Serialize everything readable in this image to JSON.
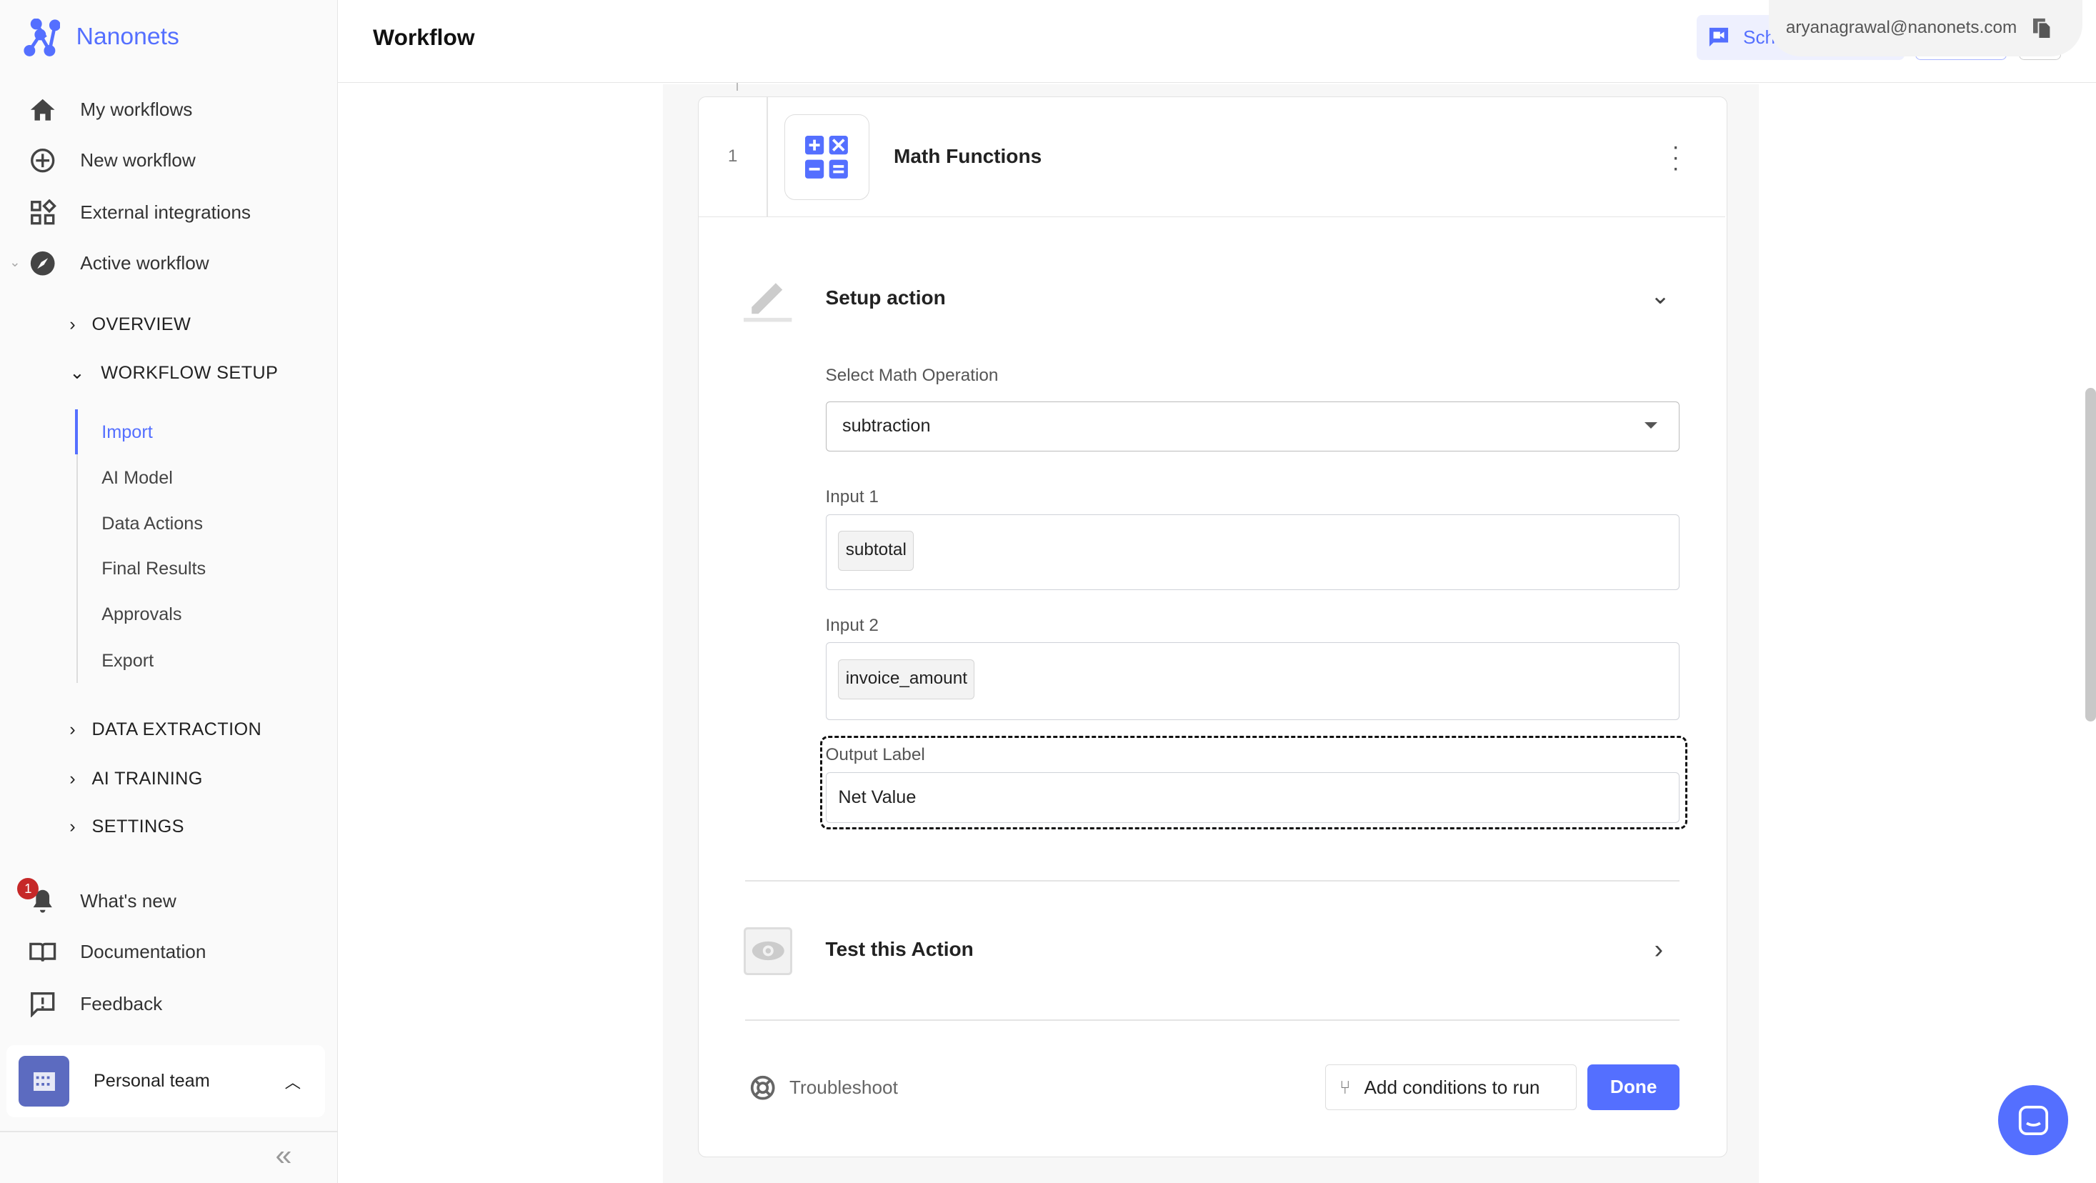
{
  "brand": {
    "name": "Nanonets",
    "color": "#546fff"
  },
  "sidebar": {
    "nav": [
      {
        "label": "My workflows",
        "icon": "home-icon"
      },
      {
        "label": "New workflow",
        "icon": "plus-circle-icon"
      },
      {
        "label": "External integrations",
        "icon": "widgets-icon"
      },
      {
        "label": "Active workflow",
        "icon": "compass-icon"
      }
    ],
    "sections": [
      {
        "label": "OVERVIEW"
      },
      {
        "label": "WORKFLOW SETUP"
      }
    ],
    "setup_items": [
      "Import",
      "AI Model",
      "Data Actions",
      "Final Results",
      "Approvals",
      "Export"
    ],
    "active_item": "Import",
    "more_sections": [
      "DATA EXTRACTION",
      "AI TRAINING",
      "SETTINGS"
    ],
    "footer_nav": [
      {
        "label": "What's new",
        "icon": "bell-icon",
        "badge": "1"
      },
      {
        "label": "Documentation",
        "icon": "book-icon"
      },
      {
        "label": "Feedback",
        "icon": "feedback-icon"
      }
    ],
    "team": "Personal team"
  },
  "header": {
    "title": "Workflow",
    "schedule_label": "Sch",
    "email": "aryanagrawal@nanonets.com"
  },
  "card": {
    "step": "1",
    "title": "Math Functions",
    "setup_title": "Setup action",
    "operation_label": "Select Math Operation",
    "operation_value": "subtraction",
    "input1_label": "Input 1",
    "input1_value": "subtotal",
    "input2_label": "Input 2",
    "input2_value": "invoice_amount",
    "output_label": "Output Label",
    "output_value": "Net Value",
    "test_title": "Test this Action",
    "troubleshoot": "Troubleshoot",
    "add_conditions": "Add conditions to run",
    "done": "Done"
  }
}
